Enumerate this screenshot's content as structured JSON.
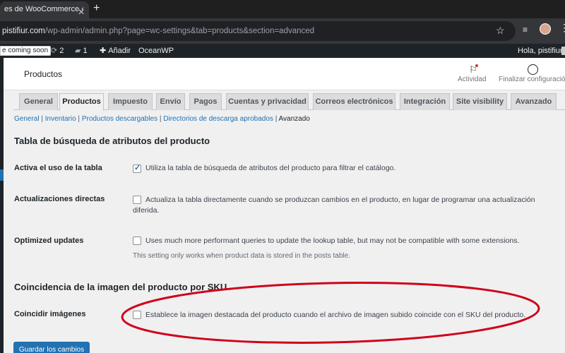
{
  "browser": {
    "tab_title": "es de WooCommerce ‹ ",
    "url_host": "pistifiur.com",
    "url_path": "/wp-admin/admin.php?page=wc-settings&tab=products&section=advanced"
  },
  "adminbar": {
    "coming_soon": "e coming soon",
    "updates_count": "2",
    "comments_count": "1",
    "add_new": "Añadir",
    "theme": "OceanWP",
    "greeting": "Hola, pistifiur"
  },
  "header": {
    "page_title": "Productos",
    "activity": "Actividad",
    "finish_setup": "Finalizar configuración"
  },
  "tabs": [
    {
      "label": "General"
    },
    {
      "label": "Productos"
    },
    {
      "label": "Impuesto"
    },
    {
      "label": "Envío"
    },
    {
      "label": "Pagos"
    },
    {
      "label": "Cuentas y privacidad"
    },
    {
      "label": "Correos electrónicos"
    },
    {
      "label": "Integración"
    },
    {
      "label": "Site visibility"
    },
    {
      "label": "Avanzado"
    }
  ],
  "subsections": {
    "general": "General",
    "inventario": "Inventario",
    "descargables": "Productos descargables",
    "directorios": "Directorios de descarga aprobados",
    "avanzado": "Avanzado",
    "sep": " | "
  },
  "section1": {
    "title": "Tabla de búsqueda de atributos del producto",
    "rows": [
      {
        "label": "Activa el uso de la tabla",
        "desc": "Utiliza la tabla de búsqueda de atributos del producto para filtrar el catálogo.",
        "checked": true
      },
      {
        "label": "Actualizaciones directas",
        "desc": "Actualiza la tabla directamente cuando se produzcan cambios en el producto, en lugar de programar una actualización diferida.",
        "checked": false
      },
      {
        "label": "Optimized updates",
        "desc": "Uses much more performant queries to update the lookup table, but may not be compatible with some extensions.",
        "help": "This setting only works when product data is stored in the posts table.",
        "checked": false
      }
    ]
  },
  "section2": {
    "title": "Coincidencia de la imagen del producto por SKU",
    "rows": [
      {
        "label": "Coincidir imágenes",
        "desc": "Establece la imagen destacada del producto cuando el archivo de imagen subido coincide con el SKU del producto.",
        "checked": false
      }
    ]
  },
  "save_button": "Guardar los cambios",
  "colors": {
    "accent": "#2271b1",
    "annotation": "#d0021b"
  }
}
